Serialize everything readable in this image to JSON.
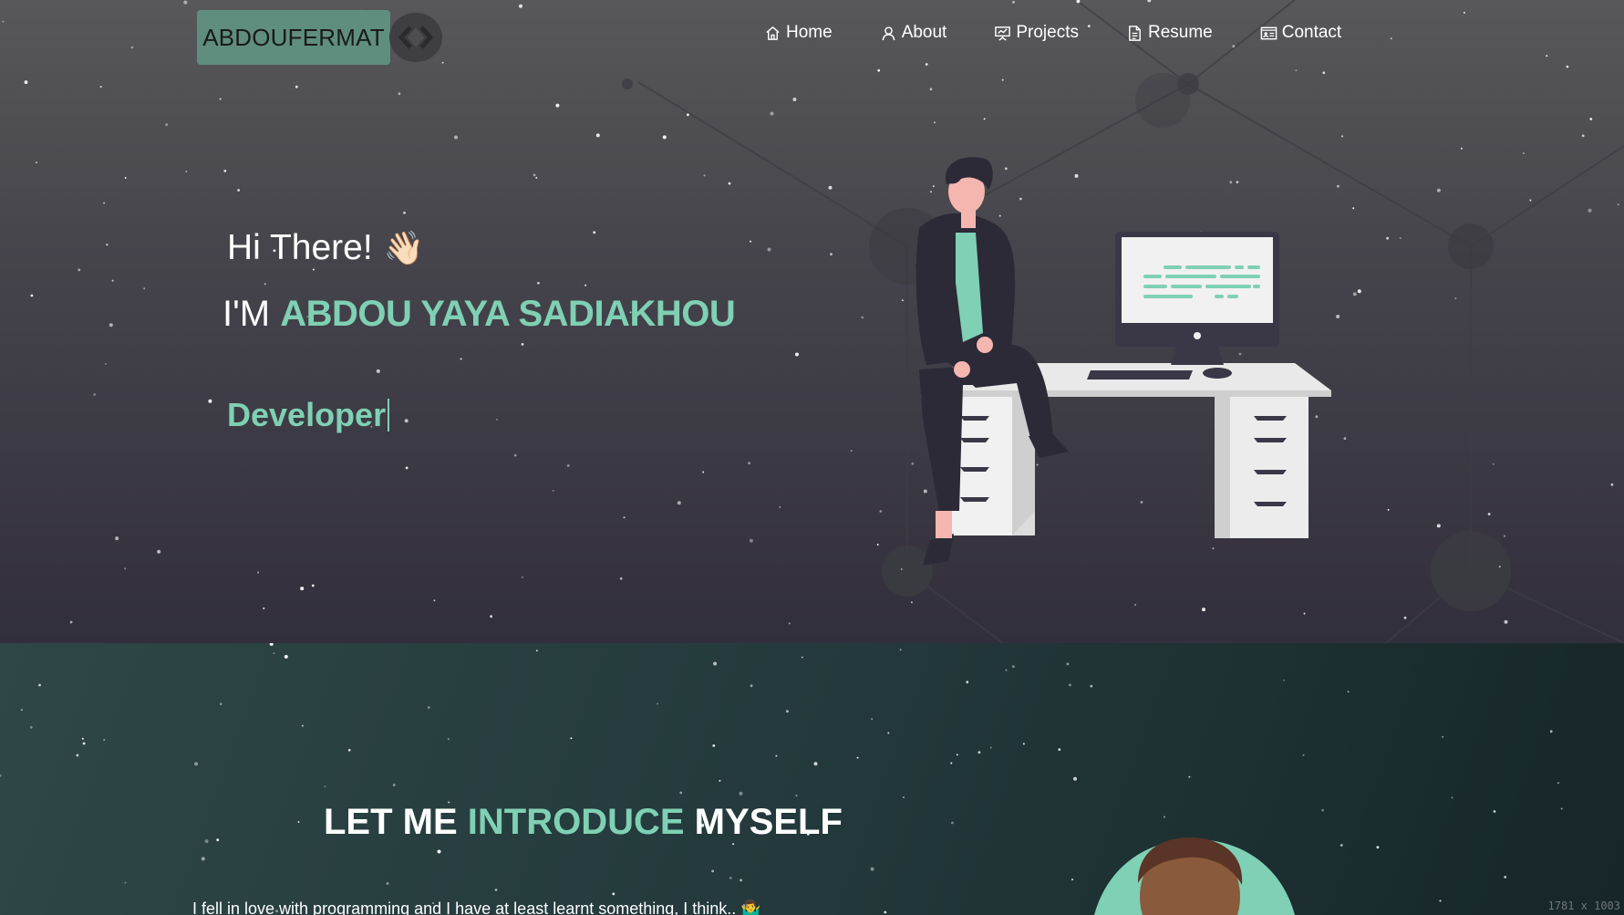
{
  "brand": {
    "logo_text": "ABDOUFERMAT",
    "logo_icon": "code-brackets-icon",
    "accent_color": "#7fd0b4",
    "logo_bg_color": "#5f8e7e"
  },
  "nav": {
    "items": [
      {
        "label": "Home",
        "icon": "home-icon"
      },
      {
        "label": "About",
        "icon": "user-icon"
      },
      {
        "label": "Projects",
        "icon": "presentation-icon"
      },
      {
        "label": "Resume",
        "icon": "document-icon"
      },
      {
        "label": "Contact",
        "icon": "contact-card-icon"
      }
    ]
  },
  "hero": {
    "greeting": "Hi There!",
    "wave_emoji": "👋🏻",
    "intro_prefix": "I'M ",
    "name": "ABDOU YAYA SADIAKHOU",
    "typed_role": "Developer"
  },
  "about": {
    "title_prefix": "LET ME ",
    "title_accent": "INTRODUCE",
    "title_suffix": " MYSELF",
    "text": "I fell in love with programming and I have at least learnt something, I think.. 🤷‍♂️"
  },
  "footer": {
    "viewport_label": "1781 x 1003"
  }
}
